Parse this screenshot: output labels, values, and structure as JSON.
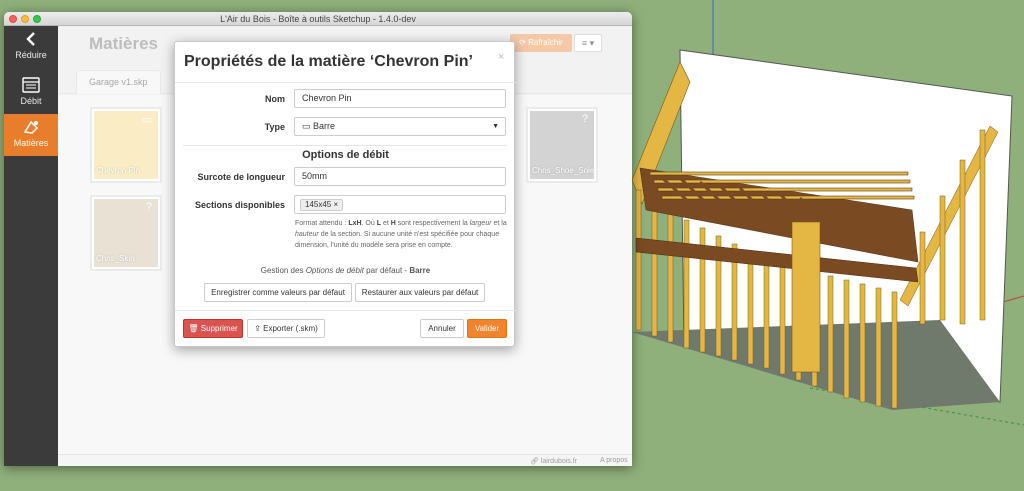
{
  "window": {
    "title": "L'Air du Bois - Boîte à outils Sketchup - 1.4.0-dev"
  },
  "sidebar": {
    "items": [
      {
        "label": "Réduire",
        "icon": "chevron-left-icon"
      },
      {
        "label": "Débit",
        "icon": "list-icon"
      },
      {
        "label": "Matières",
        "icon": "materials-icon"
      }
    ]
  },
  "main": {
    "title": "Matières",
    "refresh_label": "Rafraîchir",
    "menu_label": "≡ ▾",
    "tab_label": "Garage v1.skp",
    "materials": [
      {
        "name": "Chevron Pin",
        "color": "#f8e4a6"
      },
      {
        "name": "Chris_Skin",
        "color": "#ddd1bd"
      },
      {
        "name": "Chris_Shoe_Sole",
        "color": "#bcbcbc"
      }
    ]
  },
  "footer": {
    "site": "lairdubois.fr",
    "about": "A propos"
  },
  "modal": {
    "title": "Propriétés de la matière ‘Chevron Pin’",
    "close": "×",
    "name_label": "Nom",
    "name_value": "Chevron Pin",
    "type_label": "Type",
    "type_value": "Barre",
    "section_title": "Options de débit",
    "length_label": "Surcote de longueur",
    "length_value": "50mm",
    "sections_label": "Sections disponibles",
    "sections_tag": "145x45",
    "help": {
      "p1": "Format attendu : ",
      "lxh": "LxH",
      "p2": ". Où ",
      "l": "L",
      "p3": " et ",
      "h": "H",
      "p4": " sont respectivement la ",
      "largeur": "largeur",
      "p5": " et la ",
      "hauteur": "hauteur",
      "p6": " de la section. Si aucune unité n'est spécifiée pour chaque dimension, l'unité du modèle sera prise en compte."
    },
    "defaults_prefix": "Gestion des ",
    "defaults_italic": "Options de débit",
    "defaults_middle": " par défaut - ",
    "defaults_type": "Barre",
    "save_defaults": "Enregistrer comme valeurs par défaut",
    "restore_defaults": "Restaurer aux valeurs par défaut",
    "delete": "Supprimer",
    "export": "Exporter (.skm)",
    "cancel": "Annuler",
    "validate": "Valider"
  },
  "colors": {
    "accent": "#e87d2b",
    "sidebar": "#3b3b3b",
    "danger": "#d9534f",
    "sketchup_ground": "#8fb07b",
    "wood": "#e4b744",
    "beam": "#7a4a22"
  }
}
